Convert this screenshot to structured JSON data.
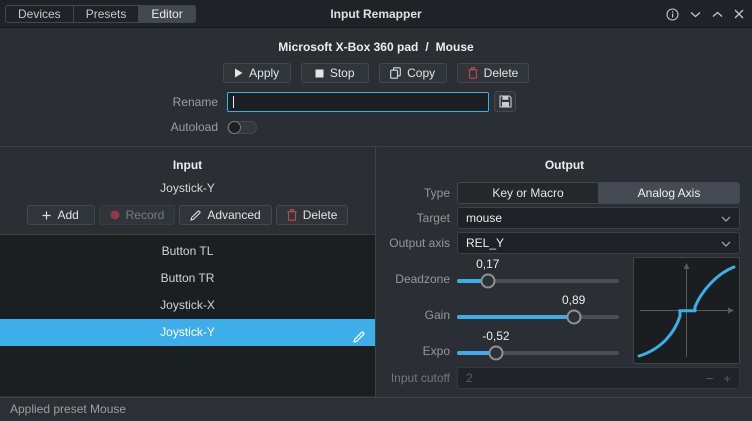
{
  "titlebar": {
    "tabs": [
      {
        "label": "Devices"
      },
      {
        "label": "Presets"
      },
      {
        "label": "Editor"
      }
    ],
    "title": "Input Remapper"
  },
  "header": {
    "device_name": "Microsoft X-Box 360 pad",
    "separator": "/",
    "preset_name": "Mouse",
    "apply_label": "Apply",
    "stop_label": "Stop",
    "copy_label": "Copy",
    "delete_label": "Delete",
    "rename_label": "Rename",
    "rename_value": "",
    "autoload_label": "Autoload"
  },
  "input_panel": {
    "title": "Input",
    "current_input": "Joystick-Y",
    "add_label": "Add",
    "record_label": "Record",
    "advanced_label": "Advanced",
    "delete_label": "Delete",
    "items": [
      {
        "label": "Button TL"
      },
      {
        "label": "Button TR"
      },
      {
        "label": "Joystick-X"
      },
      {
        "label": "Joystick-Y"
      }
    ],
    "selected_item": "Joystick-Y"
  },
  "output_panel": {
    "title": "Output",
    "type_label": "Type",
    "type_options": [
      {
        "label": "Key or Macro",
        "selected": false
      },
      {
        "label": "Analog Axis",
        "selected": true
      }
    ],
    "target_label": "Target",
    "target_value": "mouse",
    "output_axis_label": "Output axis",
    "output_axis_value": "REL_Y",
    "sliders": [
      {
        "label": "Deadzone",
        "value": "0,17",
        "percent": 19
      },
      {
        "label": "Gain",
        "value": "0,89",
        "percent": 72
      },
      {
        "label": "Expo",
        "value": "-0,52",
        "percent": 24
      }
    ],
    "input_cutoff_label": "Input cutoff",
    "input_cutoff_value": "2",
    "spin_minus": "−",
    "spin_plus": "+"
  },
  "statusbar": {
    "text": "Applied preset Mouse"
  },
  "colors": {
    "accent": "#3daee9",
    "danger": "#bf4a56",
    "selection": "#3daee9"
  }
}
